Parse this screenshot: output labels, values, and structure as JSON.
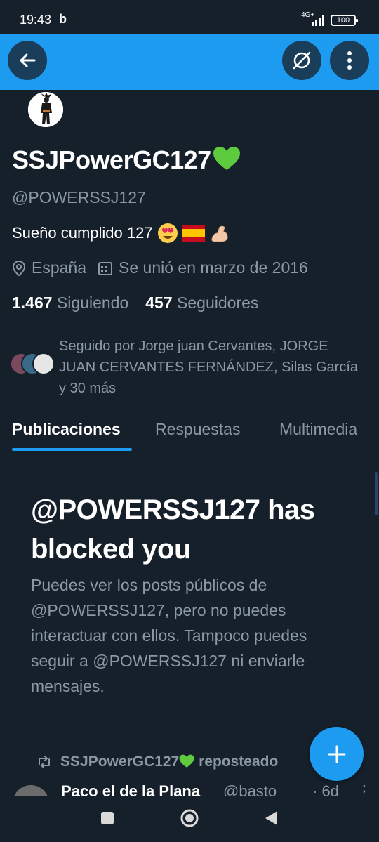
{
  "status_bar": {
    "time": "19:43",
    "app_glyph": "b",
    "network": "4G+",
    "battery": "100"
  },
  "header": {
    "back_icon": "arrow-left-icon",
    "grok_icon": "grok-icon",
    "more_icon": "vertical-dots-icon",
    "banner_color": "#1d9bf0"
  },
  "profile": {
    "display_name": "SSJPowerGC127",
    "display_name_emoji": "green-heart",
    "handle": "@POWERSSJ127",
    "bio_text": "Sueño cumplido 127",
    "bio_emojis": [
      "heart-eyes-emoji",
      "spain-flag-emoji",
      "flexed-biceps-emoji"
    ],
    "location": "España",
    "joined": "Se unió en marzo de 2016",
    "following_count": "1.467",
    "following_label": "Siguiendo",
    "followers_count": "457",
    "followers_label": "Seguidores",
    "followed_by": "Seguido por Jorge juan Cervantes, JORGE JUAN CERVANTES FERNÁNDEZ, Silas García y 30 más"
  },
  "tabs": [
    {
      "label": "Publicaciones",
      "active": true
    },
    {
      "label": "Respuestas",
      "active": false
    },
    {
      "label": "Multimedia",
      "active": false
    }
  ],
  "blocked": {
    "title": "@POWERSSJ127 has blocked you",
    "message": "Puedes ver los posts públicos de @POWERSSJ127, pero no puedes interactuar con ellos. Tampoco puedes seguir a @POWERSSJ127 ni enviarle mensajes."
  },
  "post": {
    "repost_label": "SSJPowerGC127",
    "repost_suffix": "reposteado",
    "author": "Paco el de la Plana",
    "handle": "@basto",
    "time": "· 6d",
    "more": "⋮"
  },
  "fab": {
    "icon": "plus-icon"
  },
  "colors": {
    "background": "#15202b",
    "accent": "#1d9bf0",
    "secondary_text": "#8b98a5",
    "divider": "#38444d",
    "heart_green": "#5ecb3e"
  }
}
